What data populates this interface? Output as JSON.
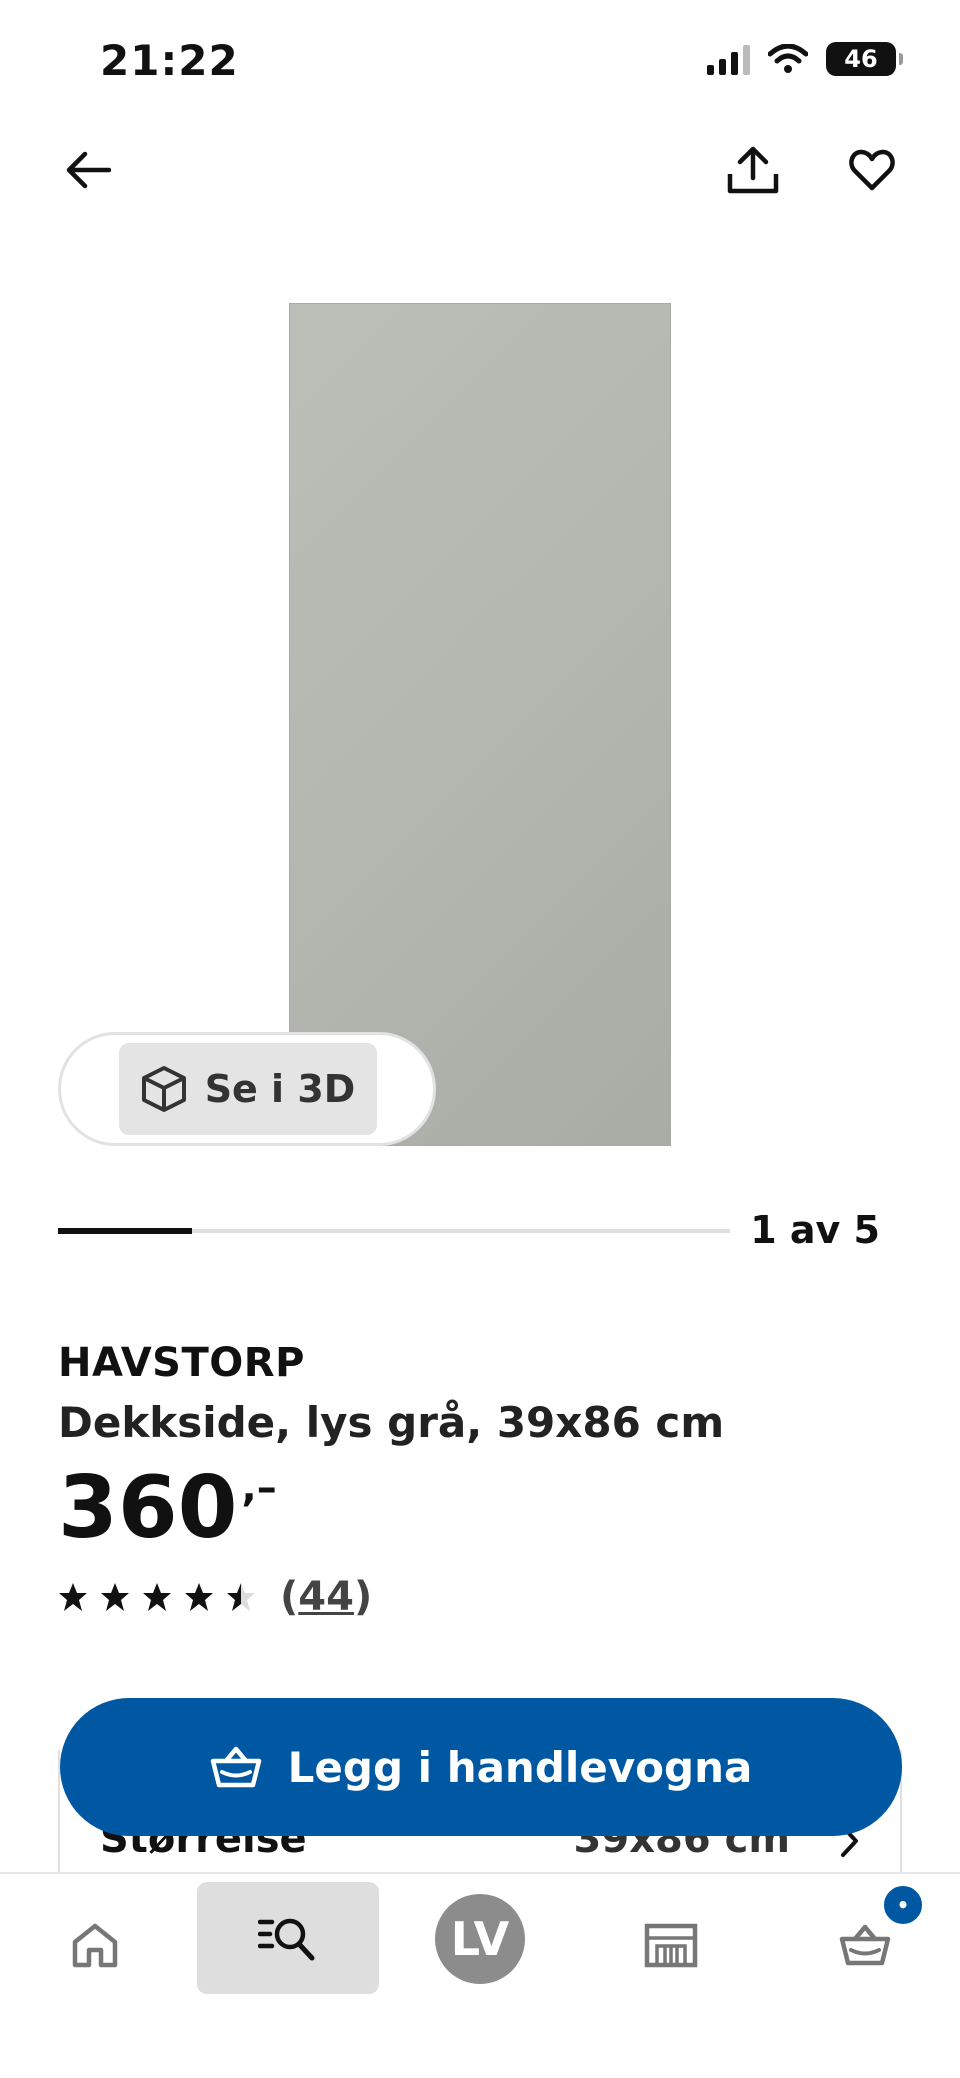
{
  "status_bar": {
    "time": "21:22",
    "battery": "46"
  },
  "colors": {
    "brand_blue": "#0058a3",
    "text": "#111111",
    "product_gray": "#b4b6b0"
  },
  "icons": {
    "back": "arrow-left-icon",
    "share": "share-icon",
    "favorite": "heart-icon",
    "view3d": "cube-icon",
    "cart": "basket-icon",
    "home": "home-icon",
    "search": "search-list-icon",
    "store": "store-icon"
  },
  "gallery": {
    "view3d_label": "Se i 3D",
    "current": 1,
    "total": 5,
    "pager_label": "1 av 5"
  },
  "product": {
    "brand": "HAVSTORP",
    "description": "Dekkside, lys grå, 39x86 cm",
    "price": "360",
    "price_suffix": ",–",
    "rating": 4.5,
    "rating_max": 5,
    "review_count_open": "(",
    "review_count": "44",
    "review_count_close": ")"
  },
  "size": {
    "label": "Størrelse",
    "value": "39x86 cm"
  },
  "cta": {
    "label": "Legg i handlevogna"
  },
  "tabbar": {
    "avatar_initials": "LV",
    "cart_badge": "•"
  }
}
